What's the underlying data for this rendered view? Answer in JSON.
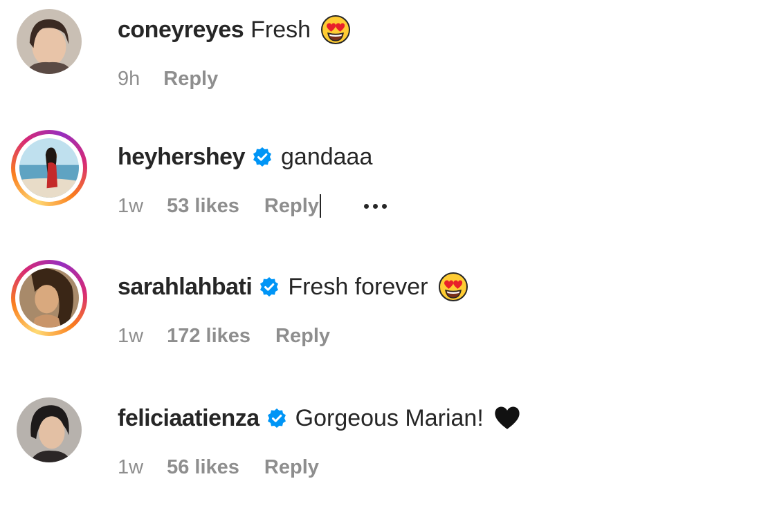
{
  "colors": {
    "text": "#262626",
    "meta": "#8e8e8e",
    "verified": "#0095f6",
    "story_ring": [
      "#feda75",
      "#fa7e1e",
      "#d62976",
      "#962fbf"
    ]
  },
  "comments": [
    {
      "username": "coneyreyes",
      "verified": false,
      "text": "Fresh",
      "trailing_icon": "heart-eyes-emoji",
      "time": "9h",
      "likes": "",
      "reply": "Reply",
      "avatar_ring": false
    },
    {
      "username": "heyhershey",
      "verified": true,
      "text": "gandaaa",
      "trailing_icon": "",
      "time": "1w",
      "likes": "53 likes",
      "reply": "Reply",
      "avatar_ring": true,
      "more_icon": "more-options-icon"
    },
    {
      "username": "sarahlahbati",
      "verified": true,
      "text": "Fresh forever",
      "trailing_icon": "heart-eyes-emoji",
      "time": "1w",
      "likes": "172 likes",
      "reply": "Reply",
      "avatar_ring": true
    },
    {
      "username": "feliciaatienza",
      "verified": true,
      "text": "Gorgeous Marian!",
      "trailing_icon": "black-heart-icon",
      "time": "1w",
      "likes": "56 likes",
      "reply": "Reply",
      "avatar_ring": false
    }
  ]
}
